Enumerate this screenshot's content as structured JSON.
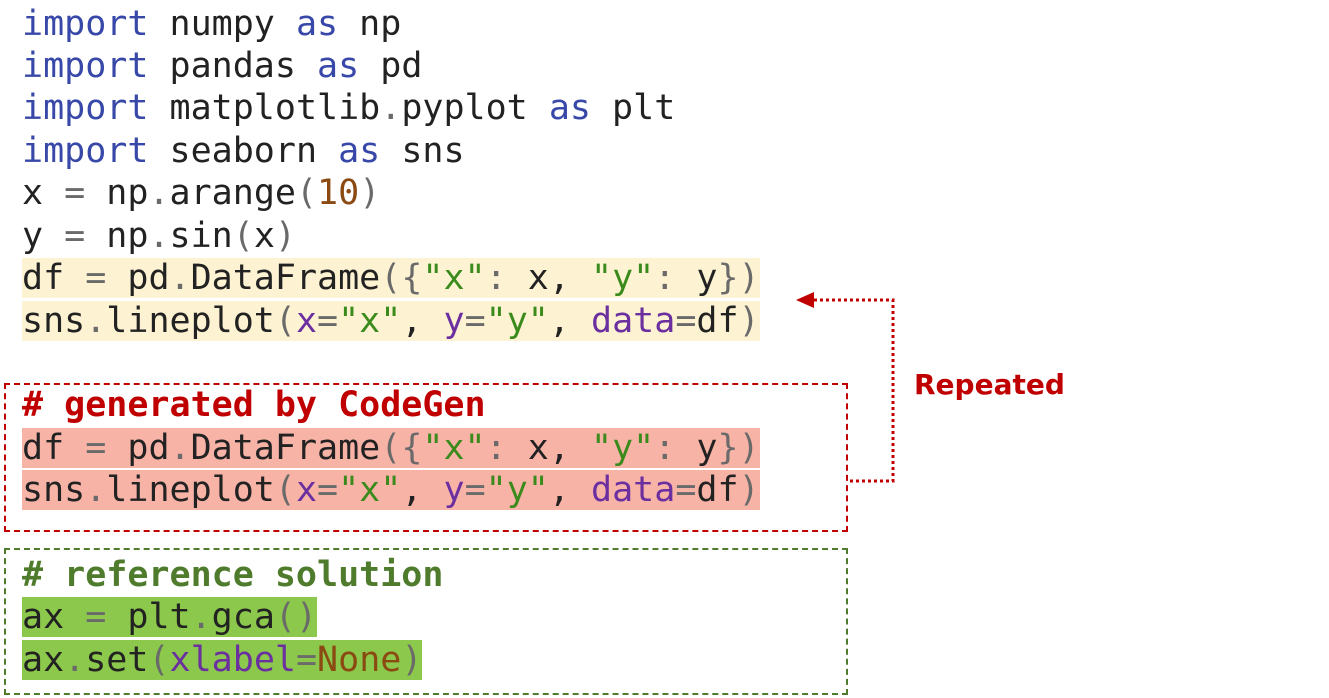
{
  "code_lines": [
    {
      "tokens": [
        [
          "kw",
          "import"
        ],
        [
          "p",
          " numpy "
        ],
        [
          "kw",
          "as"
        ],
        [
          "p",
          " np"
        ]
      ]
    },
    {
      "tokens": [
        [
          "kw",
          "import"
        ],
        [
          "p",
          " pandas "
        ],
        [
          "kw",
          "as"
        ],
        [
          "p",
          " pd"
        ]
      ]
    },
    {
      "tokens": [
        [
          "kw",
          "import"
        ],
        [
          "p",
          " matplotlib"
        ],
        [
          "punc",
          "."
        ],
        [
          "p",
          "pyplot "
        ],
        [
          "kw",
          "as"
        ],
        [
          "p",
          " plt"
        ]
      ]
    },
    {
      "tokens": [
        [
          "kw",
          "import"
        ],
        [
          "p",
          " seaborn "
        ],
        [
          "kw",
          "as"
        ],
        [
          "p",
          " sns"
        ]
      ]
    },
    {
      "tokens": [
        [
          "p",
          "x "
        ],
        [
          "punc",
          "="
        ],
        [
          "p",
          " np"
        ],
        [
          "punc",
          "."
        ],
        [
          "p",
          "arange"
        ],
        [
          "punc",
          "("
        ],
        [
          "num",
          "10"
        ],
        [
          "punc",
          ")"
        ]
      ]
    },
    {
      "tokens": [
        [
          "p",
          "y "
        ],
        [
          "punc",
          "="
        ],
        [
          "p",
          " np"
        ],
        [
          "punc",
          "."
        ],
        [
          "p",
          "sin"
        ],
        [
          "punc",
          "("
        ],
        [
          "p",
          "x"
        ],
        [
          "punc",
          ")"
        ]
      ]
    },
    {
      "highlight": "yellow",
      "tokens": [
        [
          "p",
          "df "
        ],
        [
          "punc",
          "="
        ],
        [
          "p",
          " pd"
        ],
        [
          "punc",
          "."
        ],
        [
          "p",
          "DataFrame"
        ],
        [
          "punc",
          "({"
        ],
        [
          "str",
          "\"x\""
        ],
        [
          "punc",
          ":"
        ],
        [
          "p",
          " x, "
        ],
        [
          "str",
          "\"y\""
        ],
        [
          "punc",
          ":"
        ],
        [
          "p",
          " y"
        ],
        [
          "punc",
          "})"
        ]
      ]
    },
    {
      "highlight": "yellow",
      "tokens": [
        [
          "p",
          "sns"
        ],
        [
          "punc",
          "."
        ],
        [
          "p",
          "lineplot"
        ],
        [
          "punc",
          "("
        ],
        [
          "param",
          "x"
        ],
        [
          "punc",
          "="
        ],
        [
          "str",
          "\"x\""
        ],
        [
          "p",
          ", "
        ],
        [
          "param",
          "y"
        ],
        [
          "punc",
          "="
        ],
        [
          "str",
          "\"y\""
        ],
        [
          "p",
          ", "
        ],
        [
          "param",
          "data"
        ],
        [
          "punc",
          "="
        ],
        [
          "p",
          "df"
        ],
        [
          "punc",
          ")"
        ]
      ]
    },
    {
      "comment": "red",
      "tokens": [
        [
          "c",
          "# generated by CodeGen"
        ]
      ]
    },
    {
      "highlight": "red",
      "tokens": [
        [
          "p",
          "df "
        ],
        [
          "punc",
          "="
        ],
        [
          "p",
          " pd"
        ],
        [
          "punc",
          "."
        ],
        [
          "p",
          "DataFrame"
        ],
        [
          "punc",
          "({"
        ],
        [
          "str",
          "\"x\""
        ],
        [
          "punc",
          ":"
        ],
        [
          "p",
          " x, "
        ],
        [
          "str",
          "\"y\""
        ],
        [
          "punc",
          ":"
        ],
        [
          "p",
          " y"
        ],
        [
          "punc",
          "})"
        ]
      ]
    },
    {
      "highlight": "red",
      "tokens": [
        [
          "p",
          "sns"
        ],
        [
          "punc",
          "."
        ],
        [
          "p",
          "lineplot"
        ],
        [
          "punc",
          "("
        ],
        [
          "param",
          "x"
        ],
        [
          "punc",
          "="
        ],
        [
          "str",
          "\"x\""
        ],
        [
          "p",
          ", "
        ],
        [
          "param",
          "y"
        ],
        [
          "punc",
          "="
        ],
        [
          "str",
          "\"y\""
        ],
        [
          "p",
          ", "
        ],
        [
          "param",
          "data"
        ],
        [
          "punc",
          "="
        ],
        [
          "p",
          "df"
        ],
        [
          "punc",
          ")"
        ]
      ]
    },
    {
      "comment": "green",
      "tokens": [
        [
          "c",
          "# reference solution"
        ]
      ]
    },
    {
      "highlight": "green",
      "tokens": [
        [
          "p",
          "ax "
        ],
        [
          "punc",
          "="
        ],
        [
          "p",
          " plt"
        ],
        [
          "punc",
          "."
        ],
        [
          "p",
          "gca"
        ],
        [
          "punc",
          "()"
        ]
      ]
    },
    {
      "highlight": "green",
      "tokens": [
        [
          "p",
          "ax"
        ],
        [
          "punc",
          "."
        ],
        [
          "p",
          "set"
        ],
        [
          "punc",
          "("
        ],
        [
          "param",
          "xlabel"
        ],
        [
          "punc",
          "="
        ],
        [
          "none",
          "None"
        ],
        [
          "punc",
          ")"
        ]
      ]
    }
  ],
  "annotation": {
    "label": "Repeated",
    "color": "#c00000"
  },
  "colors": {
    "keyword": "#3848a8",
    "string": "#3b8a1c",
    "parameter": "#6b2fa0",
    "number": "#8a4a12",
    "highlight_yellow": "#fdf3d2",
    "highlight_red": "#f8b3a7",
    "highlight_green": "#8cc84b",
    "box_red": "#c00000",
    "box_green": "#4e7b2c"
  }
}
